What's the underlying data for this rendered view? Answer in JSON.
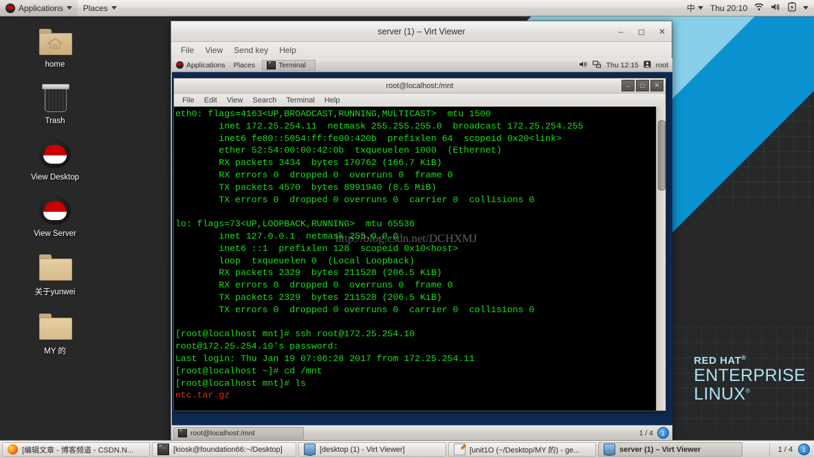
{
  "host_panel": {
    "applications": "Applications",
    "places": "Places",
    "input_method": "中",
    "clock": "Thu 20:10",
    "icons": [
      "wifi-icon",
      "volume-muted-icon",
      "battery-icon",
      "caret-down-icon"
    ]
  },
  "desktop_icons": [
    {
      "label": "home",
      "icon": "home-folder-icon"
    },
    {
      "label": "Trash",
      "icon": "trash-icon"
    },
    {
      "label": "View Desktop",
      "icon": "redhat-logo-icon"
    },
    {
      "label": "View Server",
      "icon": "redhat-logo-icon"
    },
    {
      "label": "关于yunwei",
      "icon": "folder-icon"
    },
    {
      "label": "MY 的",
      "icon": "folder-icon"
    }
  ],
  "wallpaper": {
    "brand_line1": "RED HAT",
    "brand_line2": "ENTERPRISE",
    "brand_line3": "LINUX",
    "accent_light": "#87cfe8",
    "accent_dark": "#0a91d0"
  },
  "virt_viewer": {
    "title": "server (1) – Virt Viewer",
    "menus": [
      "File",
      "View",
      "Send key",
      "Help"
    ],
    "window_buttons": [
      "minimize",
      "maximize",
      "close"
    ]
  },
  "guest_panel": {
    "applications": "Applications",
    "places": "Places",
    "window_button": "Terminal",
    "clock": "Thu 12:15",
    "user": "root",
    "icons": [
      "volume-icon",
      "network-icon",
      "user-icon"
    ]
  },
  "terminal": {
    "title": "root@localhost:/mnt",
    "menus": [
      "File",
      "Edit",
      "View",
      "Search",
      "Terminal",
      "Help"
    ],
    "watermark": "http://blog.csdn.net/DCHXMJ",
    "output": "eth0: flags=4163<UP,BROADCAST,RUNNING,MULTICAST>  mtu 1500\n        inet 172.25.254.11  netmask 255.255.255.0  broadcast 172.25.254.255\n        inet6 fe80::5054:ff:fe00:420b  prefixlen 64  scopeid 0x20<link>\n        ether 52:54:00:00:42:0b  txqueuelen 1000  (Ethernet)\n        RX packets 3434  bytes 170762 (166.7 KiB)\n        RX errors 0  dropped 0  overruns 0  frame 0\n        TX packets 4570  bytes 8991940 (8.5 MiB)\n        TX errors 0  dropped 0 overruns 0  carrier 0  collisions 0\n\nlo: flags=73<UP,LOOPBACK,RUNNING>  mtu 65536\n        inet 127.0.0.1  netmask 255.0.0.0\n        inet6 ::1  prefixlen 128  scopeid 0x10<host>\n        loop  txqueuelen 0  (Local Loopback)\n        RX packets 2329  bytes 211528 (206.5 KiB)\n        RX errors 0  dropped 0  overruns 0  frame 0\n        TX packets 2329  bytes 211528 (206.5 KiB)\n        TX errors 0  dropped 0 overruns 0  carrier 0  collisions 0\n\n[root@localhost mnt]# ssh root@172.25.254.10\nroot@172.25.254.10's password:\nLast login: Thu Jan 19 07:06:28 2017 from 172.25.254.11\n[root@localhost ~]# cd /mnt\n[root@localhost mnt]# ls\n",
    "output_red": "etc.tar.gz"
  },
  "guest_taskbar": {
    "task": "root@localhost:/mnt",
    "workspace": "1 / 4",
    "workspace_number": "1"
  },
  "host_taskbar": {
    "tasks": [
      {
        "label": "[编辑文章 - 博客频道 - CSDN.N...",
        "icon": "firefox-icon",
        "active": false
      },
      {
        "label": "[kiosk@foundation66:~/Desktop]",
        "icon": "terminal-icon",
        "active": false
      },
      {
        "label": "[desktop (1) - Virt Viewer]",
        "icon": "monitor-icon",
        "active": false
      },
      {
        "label": "[unit1O (~/Desktop/MY 的) - ge...",
        "icon": "gedit-icon",
        "active": false
      },
      {
        "label": "server (1) – Virt Viewer",
        "icon": "monitor-icon",
        "active": true
      }
    ],
    "workspace": "1 / 4",
    "workspace_number": "1"
  }
}
